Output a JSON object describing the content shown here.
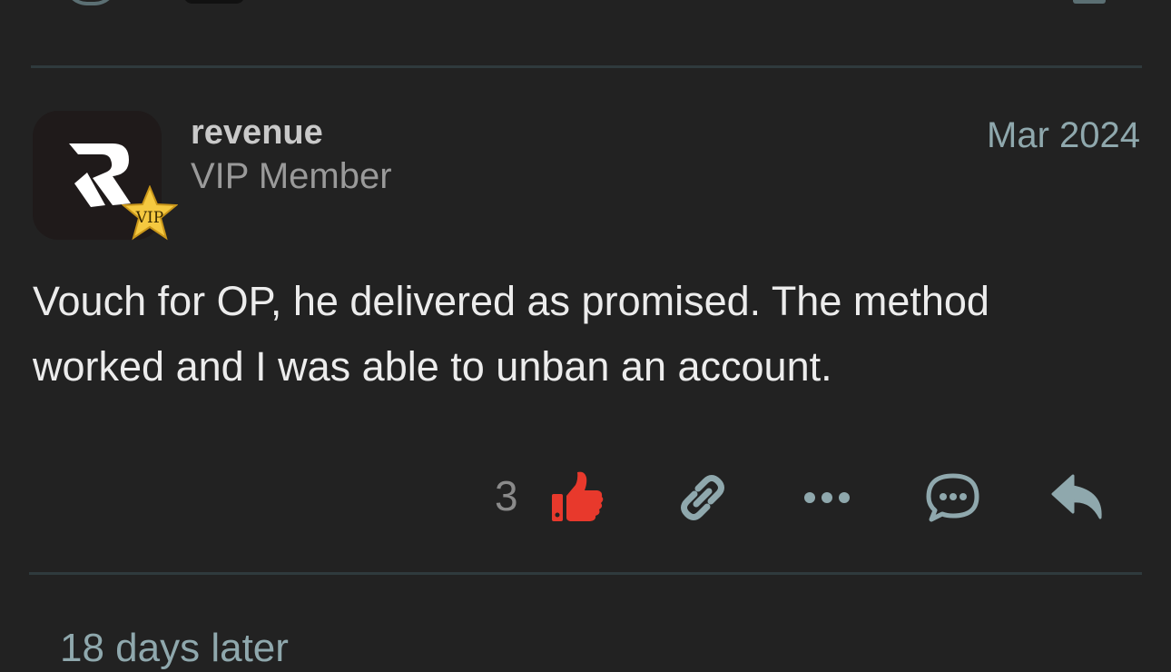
{
  "post": {
    "username": "revenue",
    "user_title": "VIP Member",
    "date": "Mar 2024",
    "avatar_badge": "VIP",
    "body": "Vouch for OP, he delivered as promised. The method worked and I was able to unban an account.",
    "like_count": "3"
  },
  "actions": {
    "like_icon": "thumbs-up-icon",
    "link_icon": "link-icon",
    "more_icon": "ellipsis-icon",
    "chat_icon": "chat-bubble-icon",
    "reply_icon": "reply-arrow-icon"
  },
  "timeline": {
    "gap_label": "18 days later"
  },
  "colors": {
    "background": "#222222",
    "like_active": "#e8392c",
    "icon_muted": "#8fa8ad",
    "divider": "#2f3a3d",
    "vip_gold": "#f5c940"
  }
}
